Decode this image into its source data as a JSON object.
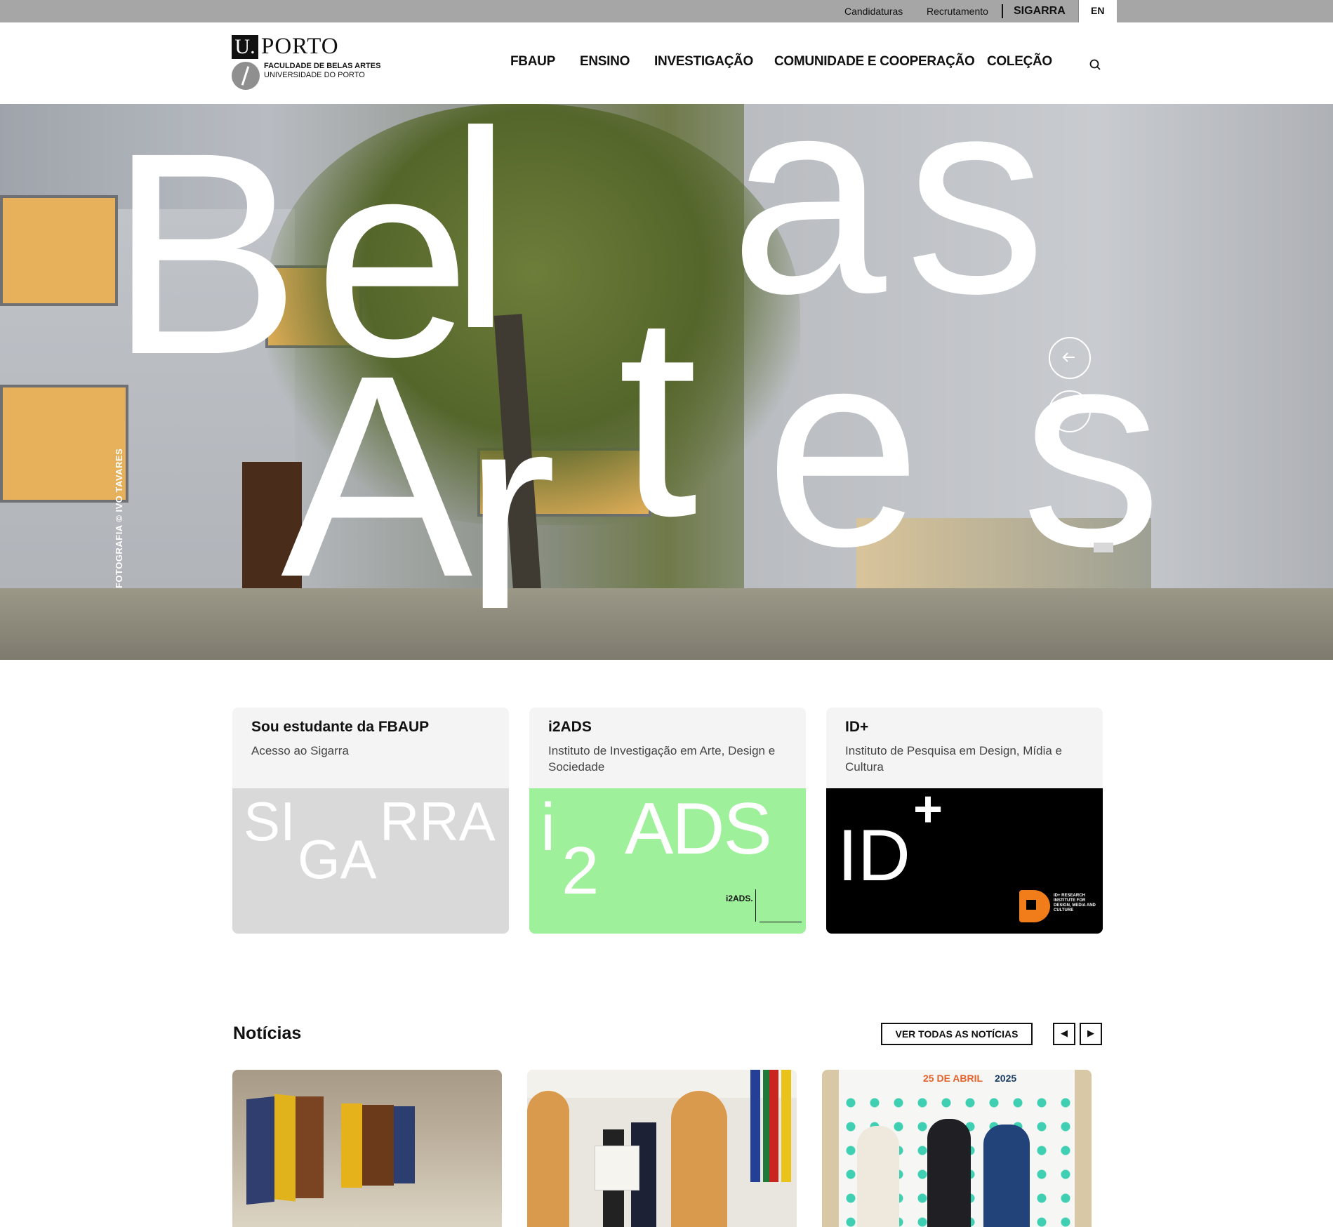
{
  "topbar": {
    "links": [
      "Candidaturas",
      "Recrutamento"
    ],
    "sigarra": "SIGARRA",
    "lang": "EN"
  },
  "logo": {
    "u": "U.",
    "porto": "PORTO",
    "faculty": "FACULDADE DE BELAS ARTES",
    "university": "UNIVERSIDADE DO PORTO"
  },
  "nav": {
    "items": [
      "FBAUP",
      "ENSINO",
      "INVESTIGAÇÃO",
      "COMUNIDADE E COOPERAÇÃO",
      "COLEÇÃO"
    ]
  },
  "hero": {
    "letters": [
      "B",
      "e",
      "l",
      "a",
      "s",
      "A",
      "r",
      "t",
      "e",
      "s"
    ],
    "credit": "FOTOGRAFIA © IVO TAVARES",
    "prev_icon": "arrow-left-icon"
  },
  "cards": [
    {
      "title": "Sou estudante da FBAUP",
      "subtitle": "Acesso ao Sigarra",
      "art": [
        "SI",
        "GA",
        "RRA"
      ],
      "bg": "#d9d9d9"
    },
    {
      "title": "i2ADS",
      "subtitle": "Instituto de Investigação em Arte, Design e Sociedade",
      "art": [
        "i",
        "2",
        "ADS"
      ],
      "badge": "i2ADS.",
      "bg": "#9ff09a"
    },
    {
      "title": "ID+",
      "subtitle": "Instituto de Pesquisa em Design, Mídia e Cultura",
      "art": [
        "ID",
        "+"
      ],
      "badge": "ID+ RESEARCH INSTITUTE FOR DESIGN, MEDIA AND CULTURE",
      "bg": "#000000",
      "accent": "#f07d1a"
    }
  ],
  "news": {
    "title": "Notícias",
    "view_all": "VER TODAS AS NOTÍCIAS",
    "prev": "◀",
    "next": "▶",
    "banner_text": "25 DE ABRIL",
    "banner_year": "2025"
  }
}
